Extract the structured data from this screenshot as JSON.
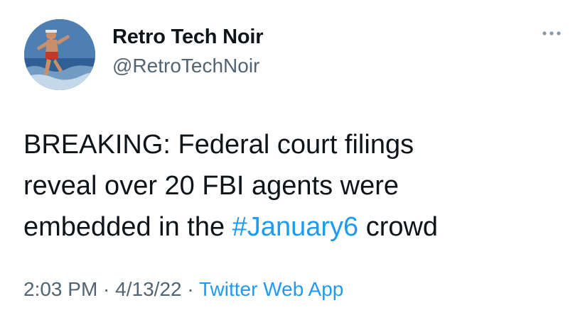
{
  "tweet": {
    "author": {
      "display_name": "Retro Tech Noir",
      "handle": "@RetroTechNoir"
    },
    "text": {
      "line1": "BREAKING: Federal court filings",
      "line2": "reveal over 20 FBI agents were",
      "line3_before": "embedded in the ",
      "line3_hashtag": "#January6",
      "line3_after": " crowd"
    },
    "meta": {
      "time": "2:03 PM",
      "separator1": " · ",
      "date": "4/13/22",
      "separator2": " · ",
      "source": "Twitter Web App"
    },
    "icons": {
      "more": "more-horizontal-icon"
    }
  },
  "colors": {
    "text": "#0f1419",
    "secondary": "#536471",
    "link": "#1d9bf0",
    "background": "#ffffff"
  }
}
